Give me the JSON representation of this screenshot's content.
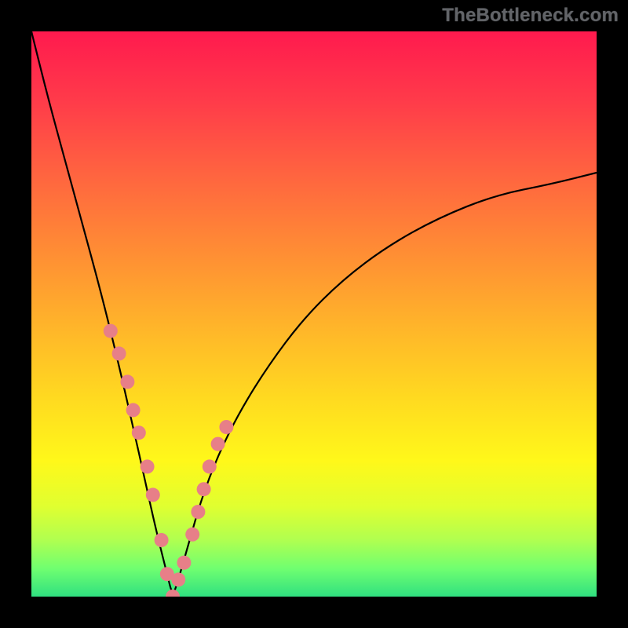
{
  "watermark": "TheBottleneck.com",
  "chart_data": {
    "type": "line",
    "title": "",
    "xlabel": "",
    "ylabel": "",
    "xlim": [
      0,
      100
    ],
    "ylim": [
      0,
      100
    ],
    "optimal_x": 25,
    "curve": {
      "description": "Bottleneck curve: y approaches 0 (green/optimal) near the minimum at x≈25, rising sharply to the left and more gradually to the right toward red (high bottleneck).",
      "x": [
        0,
        3,
        6,
        9,
        12,
        15,
        18,
        20,
        22,
        24,
        25,
        26,
        28,
        30,
        33,
        37,
        42,
        48,
        55,
        63,
        72,
        82,
        92,
        100
      ],
      "y": [
        100,
        88,
        77,
        66,
        55,
        43,
        30,
        21,
        12,
        4,
        0,
        3,
        10,
        17,
        25,
        33,
        41,
        49,
        56,
        62,
        67,
        71,
        73,
        75
      ]
    },
    "markers": {
      "color": "#e77f88",
      "radius_px": 9,
      "x": [
        14,
        15.5,
        17,
        18,
        19,
        20.5,
        21.5,
        23,
        24,
        25,
        26,
        27,
        28.5,
        29.5,
        30.5,
        31.5,
        33,
        34.5
      ],
      "y": [
        47,
        43,
        38,
        33,
        29,
        23,
        18,
        10,
        4,
        0,
        3,
        6,
        11,
        15,
        19,
        23,
        27,
        30
      ]
    }
  }
}
